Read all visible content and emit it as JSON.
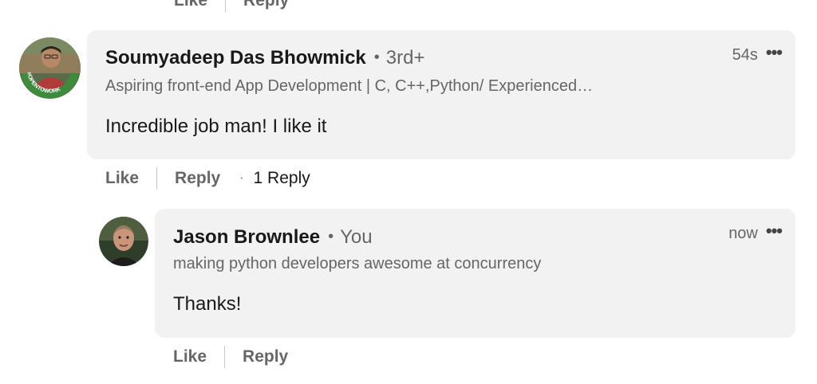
{
  "previous": {
    "like_label": "Like",
    "reply_label": "Reply"
  },
  "comment": {
    "author": "Soumyadeep Das Bhowmick",
    "degree": "3rd+",
    "headline": "Aspiring front-end App Development | C, C++,Python/ Experienced…",
    "time": "54s",
    "more_icon": "•••",
    "text": "Incredible job man! I like it",
    "like_label": "Like",
    "reply_label": "Reply",
    "replies_label": "1 Reply",
    "badge_text": "#OPENTOWORK",
    "badge_color": "#3d8c3d"
  },
  "reply": {
    "author": "Jason Brownlee",
    "degree": "You",
    "headline": "making python developers awesome at concurrency",
    "time": "now",
    "more_icon": "•••",
    "text": "Thanks!",
    "like_label": "Like",
    "reply_label": "Reply"
  },
  "colors": {
    "bubble": "#f2f2f2",
    "secondary_text": "#666666",
    "primary_text": "#191919"
  }
}
